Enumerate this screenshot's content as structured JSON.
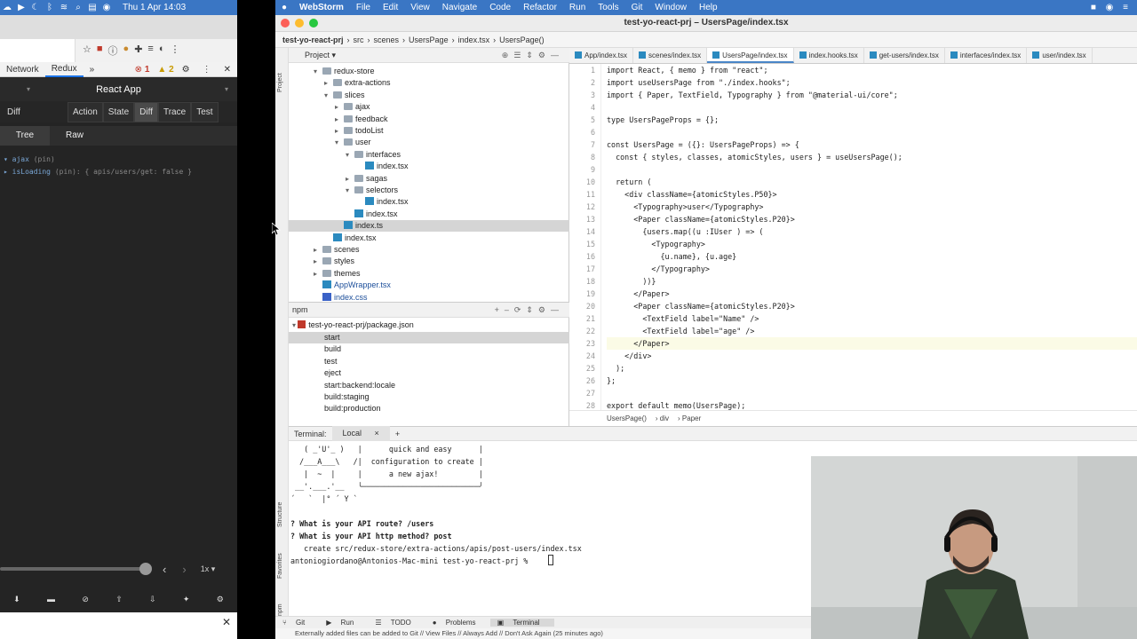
{
  "mac_left": {
    "time": "Thu 1 Apr  14:03"
  },
  "devtools": {
    "tabs": [
      "Network",
      "Redux",
      "»"
    ],
    "errors": "1",
    "warnings": "2",
    "redux_title": "React App",
    "mode_label": "Diff",
    "modes": [
      "Action",
      "State",
      "Diff",
      "Trace",
      "Test"
    ],
    "views": [
      "Tree",
      "Raw"
    ],
    "diff_lines": [
      {
        "key": "▾ ajax",
        "tag": "(pin)",
        "value": ""
      },
      {
        "key": "  ▸ isLoading",
        "tag": "(pin)",
        "value": ": { apis/users/get: false }"
      }
    ],
    "speed": "1x"
  },
  "macbar": {
    "app": "WebStorm",
    "menus": [
      "File",
      "Edit",
      "View",
      "Navigate",
      "Code",
      "Refactor",
      "Run",
      "Tools",
      "Git",
      "Window",
      "Help"
    ]
  },
  "ide": {
    "title": "test-yo-react-prj – UsersPage/index.tsx",
    "breadcrumbs": [
      "test-yo-react-prj",
      "src",
      "scenes",
      "UsersPage",
      "index.tsx",
      "UsersPage()"
    ],
    "project_label": "Project",
    "tree": [
      {
        "label": "redux-store",
        "depth": 0,
        "type": "folder",
        "arrow": "▾"
      },
      {
        "label": "extra-actions",
        "depth": 1,
        "type": "folder",
        "arrow": "▸"
      },
      {
        "label": "slices",
        "depth": 1,
        "type": "folder",
        "arrow": "▾"
      },
      {
        "label": "ajax",
        "depth": 2,
        "type": "folder",
        "arrow": "▸"
      },
      {
        "label": "feedback",
        "depth": 2,
        "type": "folder",
        "arrow": "▸"
      },
      {
        "label": "todoList",
        "depth": 2,
        "type": "folder",
        "arrow": "▸"
      },
      {
        "label": "user",
        "depth": 2,
        "type": "folder",
        "arrow": "▾"
      },
      {
        "label": "interfaces",
        "depth": 3,
        "type": "folder",
        "arrow": "▾"
      },
      {
        "label": "index.tsx",
        "depth": 4,
        "type": "tsx",
        "arrow": ""
      },
      {
        "label": "sagas",
        "depth": 3,
        "type": "folder",
        "arrow": "▸"
      },
      {
        "label": "selectors",
        "depth": 3,
        "type": "folder",
        "arrow": "▾"
      },
      {
        "label": "index.tsx",
        "depth": 4,
        "type": "tsx",
        "arrow": ""
      },
      {
        "label": "index.tsx",
        "depth": 3,
        "type": "tsx",
        "arrow": ""
      },
      {
        "label": "index.ts",
        "depth": 2,
        "type": "tsx",
        "arrow": "",
        "selected": true
      },
      {
        "label": "index.tsx",
        "depth": 1,
        "type": "tsx",
        "arrow": ""
      },
      {
        "label": "scenes",
        "depth": 0,
        "type": "folder",
        "arrow": "▸"
      },
      {
        "label": "styles",
        "depth": 0,
        "type": "folder",
        "arrow": "▸"
      },
      {
        "label": "themes",
        "depth": 0,
        "type": "folder",
        "arrow": "▸"
      },
      {
        "label": "AppWrapper.tsx",
        "depth": 0,
        "type": "tsx",
        "arrow": ""
      },
      {
        "label": "index.css",
        "depth": 0,
        "type": "css",
        "arrow": ""
      }
    ],
    "npm_label": "npm",
    "npm_package": "test-yo-react-prj/package.json",
    "npm_scripts": [
      "start",
      "build",
      "test",
      "eject",
      "start:backend:locale",
      "build:staging",
      "build:production"
    ],
    "editor_tabs": [
      "App/index.tsx",
      "scenes/index.tsx",
      "UsersPage/index.tsx",
      "index.hooks.tsx",
      "get-users/index.tsx",
      "interfaces/index.tsx",
      "user/index.tsx"
    ],
    "active_tab": 2,
    "code_lines": [
      "import React, { memo } from \"react\";",
      "import useUsersPage from \"./index.hooks\";",
      "import { Paper, TextField, Typography } from \"@material-ui/core\";",
      "",
      "type UsersPageProps = {};",
      "",
      "const UsersPage = ({}: UsersPageProps) => {",
      "  const { styles, classes, atomicStyles, users } = useUsersPage();",
      "",
      "  return (",
      "    <div className={atomicStyles.P50}>",
      "      <Typography>user</Typography>",
      "      <Paper className={atomicStyles.P20}>",
      "        {users.map((u :IUser ) => (",
      "          <Typography>",
      "            {u.name}, {u.age}",
      "          </Typography>",
      "        ))}",
      "      </Paper>",
      "      <Paper className={atomicStyles.P20}>",
      "        <TextField label=\"Name\" />",
      "        <TextField label=\"age\" />",
      "      </Paper>",
      "    </div>",
      "  );",
      "};",
      "",
      "export default memo(UsersPage);"
    ],
    "current_line": 23,
    "code_breadcrumbs": [
      "UsersPage()",
      "div",
      "Paper"
    ],
    "terminal_tabs": [
      "Terminal:",
      "Local",
      "×",
      "+"
    ],
    "terminal_lines": [
      "   ( _'U'_ )   |      quick and easy      |",
      "  /___A___\\   /|  configuration to create |",
      "   |  ~  |     |      a new ajax!         |",
      " __'.___.'__   ╰──────────────────────────╯",
      "´   `  |° ´ Y `",
      "",
      "? What is your API route? /users",
      "? What is your API http method? post",
      "   create src/redux-store/extra-actions/apis/post-users/index.tsx",
      "antoniogiordano@Antonios-Mac-mini test-yo-react-prj % "
    ],
    "bottom_tools": [
      "Git",
      "Run",
      "TODO",
      "Problems",
      "Terminal"
    ],
    "status": "Externally added files can be added to Git // View Files // Always Add // Don't Ask Again (25 minutes ago)",
    "side_labels": [
      "Project",
      "Structure",
      "Favorites",
      "npm"
    ]
  }
}
